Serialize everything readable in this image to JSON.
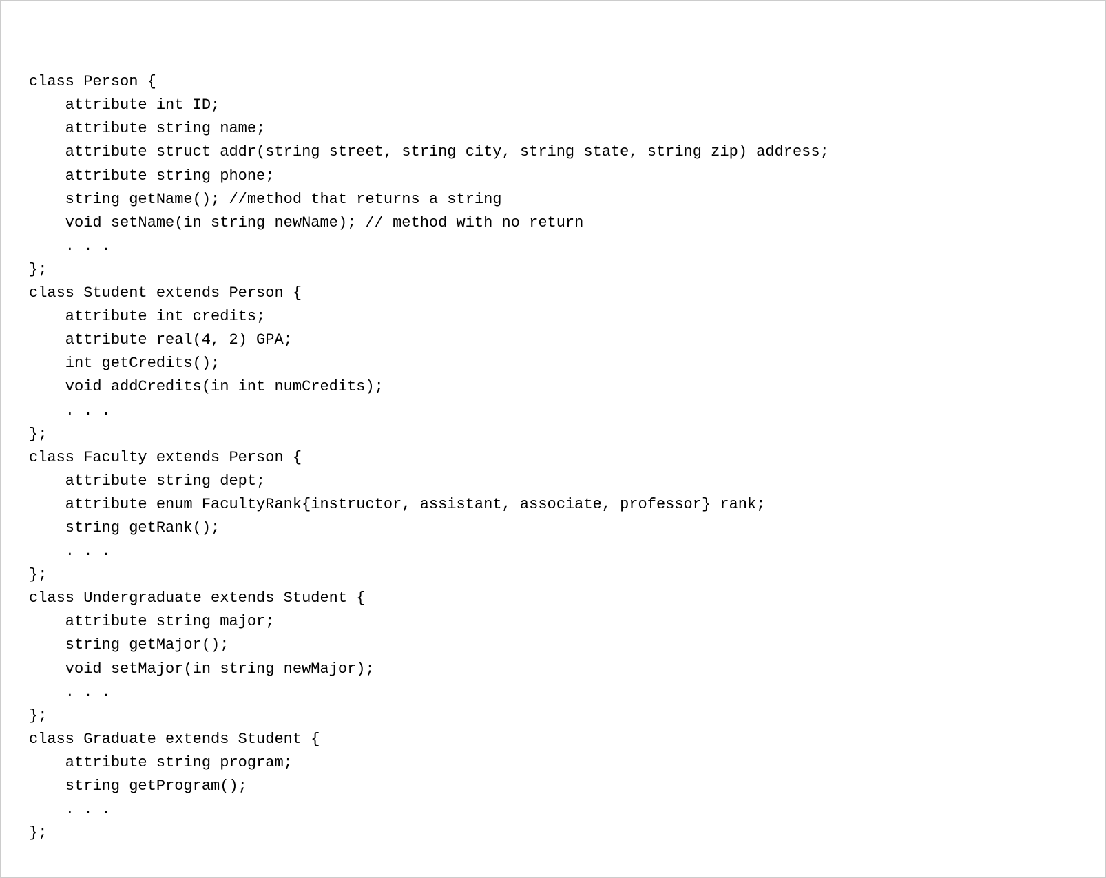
{
  "code": {
    "lines": [
      "class Person {",
      "    attribute int ID;",
      "    attribute string name;",
      "    attribute struct addr(string street, string city, string state, string zip) address;",
      "    attribute string phone;",
      "    string getName(); //method that returns a string",
      "    void setName(in string newName); // method with no return",
      "    . . .",
      "};",
      "class Student extends Person {",
      "    attribute int credits;",
      "    attribute real(4, 2) GPA;",
      "    int getCredits();",
      "    void addCredits(in int numCredits);",
      "    . . .",
      "};",
      "class Faculty extends Person {",
      "    attribute string dept;",
      "    attribute enum FacultyRank{instructor, assistant, associate, professor} rank;",
      "    string getRank();",
      "    . . .",
      "};",
      "class Undergraduate extends Student {",
      "    attribute string major;",
      "    string getMajor();",
      "    void setMajor(in string newMajor);",
      "    . . .",
      "};",
      "class Graduate extends Student {",
      "    attribute string program;",
      "    string getProgram();",
      "    . . .",
      "};"
    ]
  }
}
